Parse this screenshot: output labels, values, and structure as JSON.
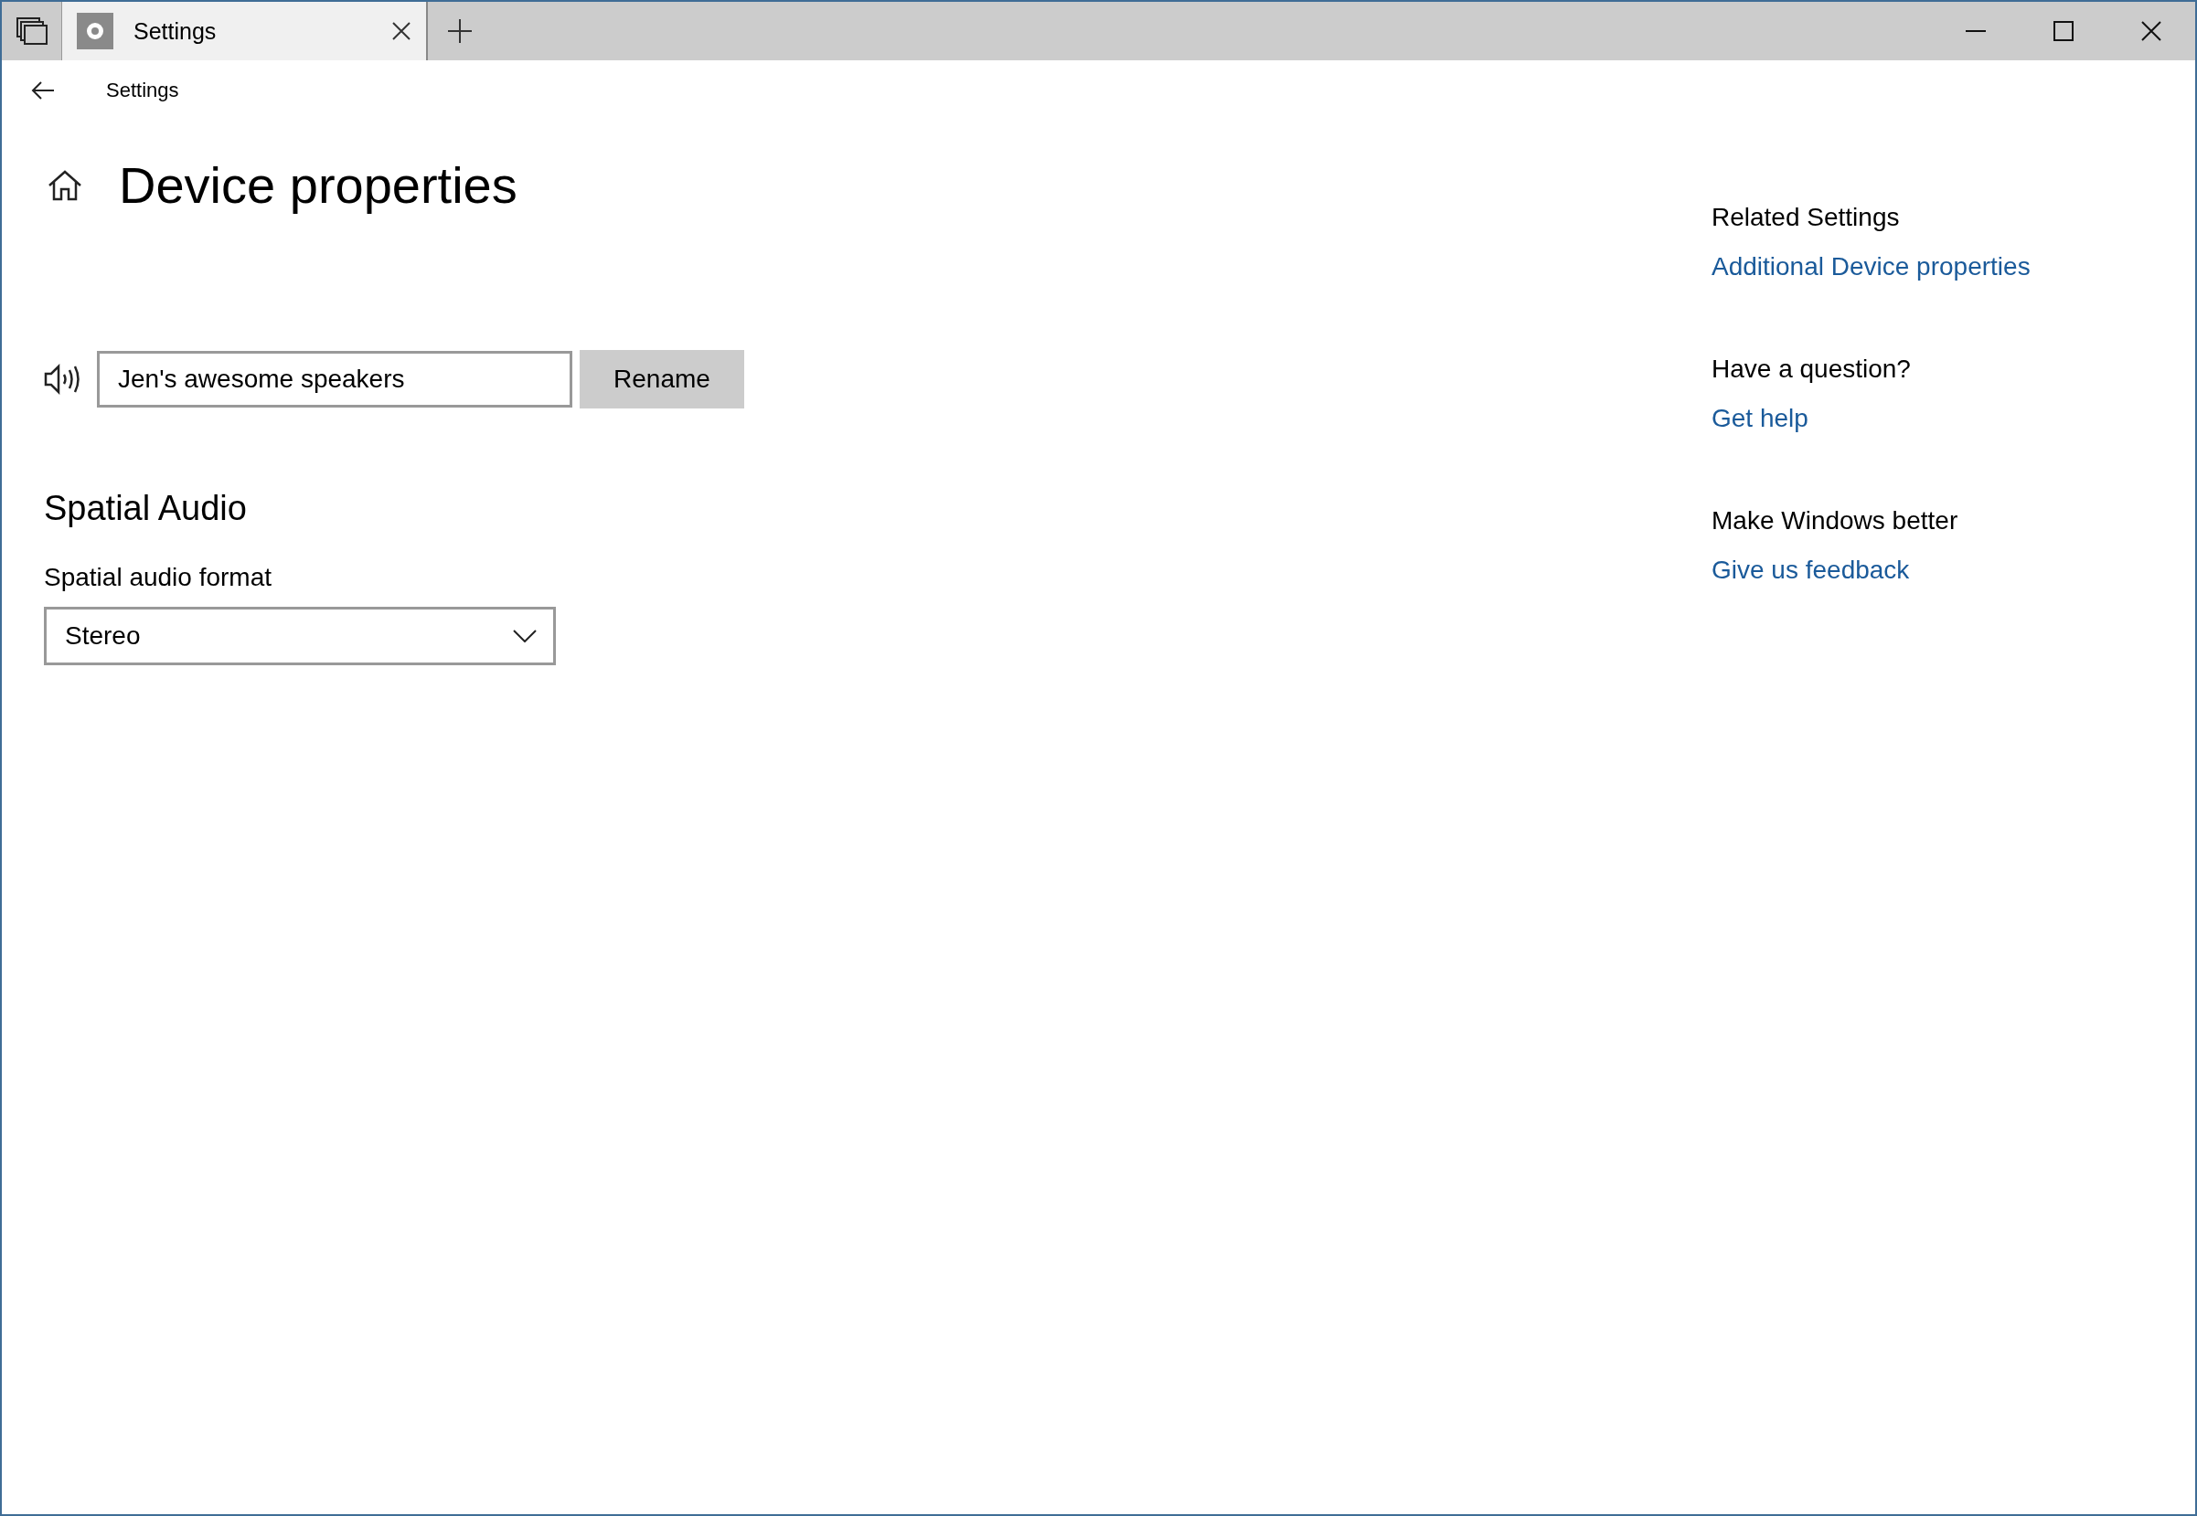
{
  "window": {
    "tab_title": "Settings"
  },
  "nav": {
    "title": "Settings"
  },
  "page": {
    "title": "Device properties"
  },
  "device": {
    "name_value": "Jen's awesome speakers",
    "rename_button": "Rename"
  },
  "spatial_audio": {
    "heading": "Spatial Audio",
    "format_label": "Spatial audio format",
    "format_value": "Stereo"
  },
  "sidebar": {
    "sections": [
      {
        "heading": "Related Settings",
        "link": "Additional Device properties"
      },
      {
        "heading": "Have a question?",
        "link": "Get help"
      },
      {
        "heading": "Make Windows better",
        "link": "Give us feedback"
      }
    ]
  }
}
